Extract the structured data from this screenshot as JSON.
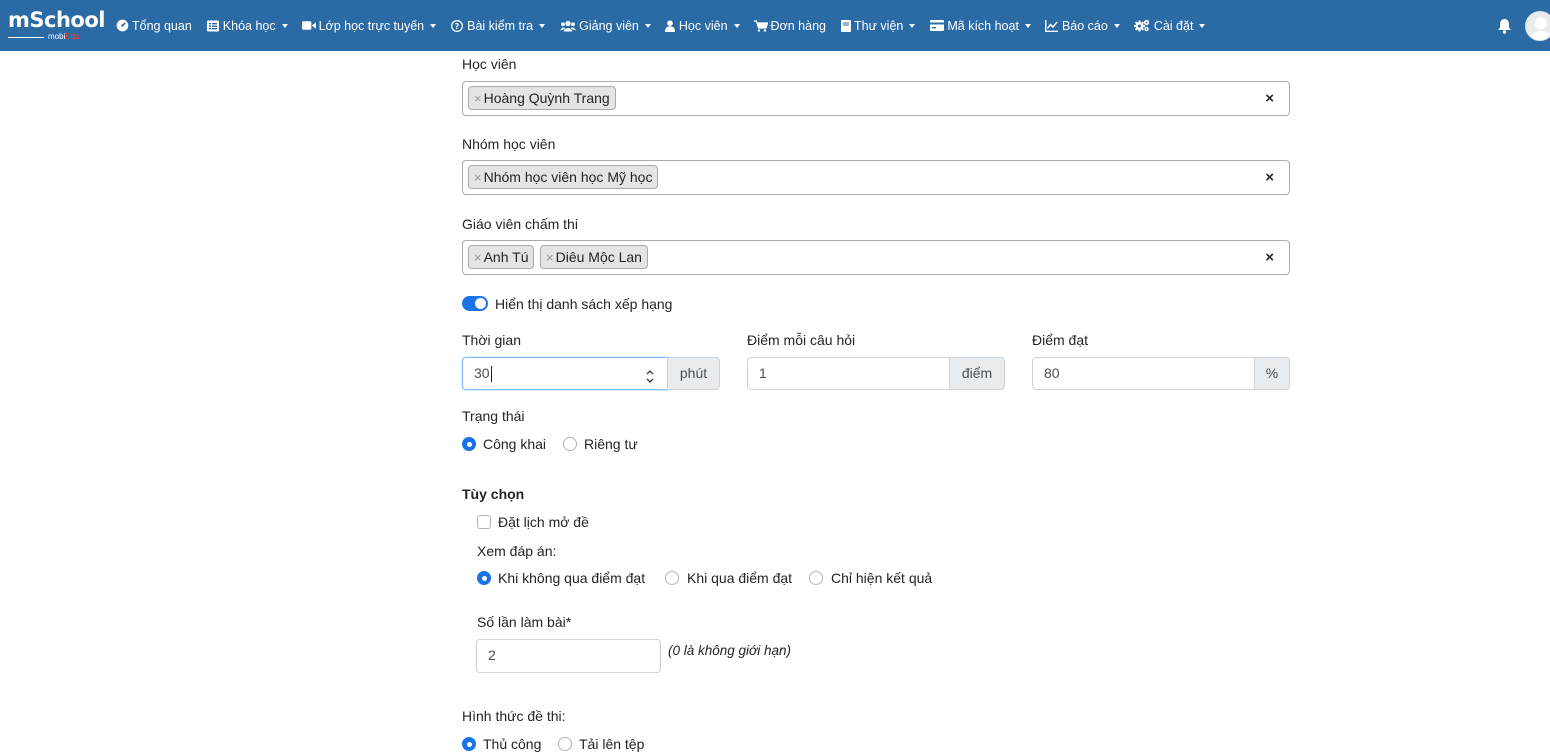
{
  "app": {
    "logo_text_part1": "m",
    "logo_text_part2": "School",
    "logo_sub_part1": "mobi",
    "logo_sub_part2": "Edu"
  },
  "nav": {
    "items": [
      {
        "label": "Tổng quan",
        "icon": "dashboard-icon",
        "caret": false
      },
      {
        "label": "Khóa học",
        "icon": "list-icon",
        "caret": true
      },
      {
        "label": "Lớp học trực tuyến",
        "icon": "video-camera-icon",
        "caret": true
      },
      {
        "label": "Bài kiểm tra",
        "icon": "question-circle-icon",
        "caret": true
      },
      {
        "label": "Giảng viên",
        "icon": "users-icon",
        "caret": true
      },
      {
        "label": "Học viên",
        "icon": "user-icon",
        "caret": true
      },
      {
        "label": "Đơn hàng",
        "icon": "shopping-cart-icon",
        "caret": false
      },
      {
        "label": "Thư viện",
        "icon": "book-icon",
        "caret": true
      },
      {
        "label": "Mã kích hoạt",
        "icon": "credit-card-icon",
        "caret": true
      },
      {
        "label": "Báo cáo",
        "icon": "line-chart-icon",
        "caret": true
      },
      {
        "label": "Cài đặt",
        "icon": "gears-icon",
        "caret": true
      }
    ]
  },
  "form": {
    "students": {
      "label": "Học viên",
      "tags": [
        "Hoàng Quỳnh Trang"
      ]
    },
    "student_groups": {
      "label": "Nhóm học viên",
      "tags": [
        "Nhóm học viên học Mỹ học"
      ]
    },
    "graders": {
      "label": "Giáo viên chấm thi",
      "tags": [
        "Anh Tú",
        "Diêu Mộc Lan"
      ]
    },
    "tag_remove": "×",
    "clear_all": "×",
    "show_ranking": {
      "label": "Hiển thị danh sách xếp hạng",
      "checked": true
    },
    "duration": {
      "label": "Thời gian",
      "value": "30",
      "unit": "phút"
    },
    "points_per_question": {
      "label": "Điểm mỗi câu hỏi",
      "value": "1",
      "unit": "điểm"
    },
    "pass_score": {
      "label": "Điểm đạt",
      "value": "80",
      "unit": "%"
    },
    "status": {
      "label": "Trạng thái",
      "options": [
        {
          "label": "Công khai",
          "selected": true
        },
        {
          "label": "Riêng tư",
          "selected": false
        }
      ]
    },
    "options_heading": "Tùy chọn",
    "schedule_open": {
      "label": "Đặt lịch mở đề",
      "checked": false
    },
    "view_answers": {
      "label": "Xem đáp án:",
      "options": [
        {
          "label": "Khi không qua điểm đạt",
          "selected": true
        },
        {
          "label": "Khi qua điểm đạt",
          "selected": false
        },
        {
          "label": "Chỉ hiện kết quả",
          "selected": false
        }
      ]
    },
    "attempts": {
      "label": "Số lần làm bài*",
      "value": "2",
      "hint": "(0 là không giới hạn)"
    },
    "exam_format": {
      "label": "Hình thức đề thi:",
      "options": [
        {
          "label": "Thủ công",
          "selected": true
        },
        {
          "label": "Tải lên tệp",
          "selected": false
        }
      ]
    }
  },
  "colors": {
    "navbar_bg": "#2a6aa5",
    "accent": "#1a73e8",
    "logo_red": "#e23c3c"
  }
}
